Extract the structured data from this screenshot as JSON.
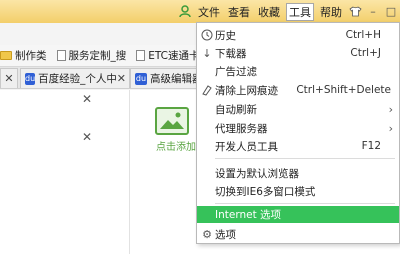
{
  "menubar": {
    "file": "文件",
    "view": "查看",
    "favorites": "收藏",
    "tools": "工具",
    "help": "帮助"
  },
  "bookmarks": [
    {
      "label": "制作类",
      "icon": "folder-icon"
    },
    {
      "label": "服务定制_搜",
      "icon": "page-icon"
    },
    {
      "label": "ETC速通卡",
      "icon": "page-icon"
    }
  ],
  "tabs": {
    "tab1_label": "百度经验_个人中",
    "tab2_label": "高级编辑器"
  },
  "content": {
    "photo_label": "点击添加"
  },
  "tools_menu": {
    "items": [
      {
        "label": "历史",
        "shortcut": "Ctrl+H",
        "icon": "history-icon"
      },
      {
        "label": "下载器",
        "shortcut": "Ctrl+J",
        "icon": "download-icon"
      },
      {
        "label": "广告过滤",
        "shortcut": "",
        "icon": ""
      },
      {
        "label": "清除上网痕迹",
        "shortcut": "Ctrl+Shift+Delete",
        "icon": "clear-icon"
      },
      {
        "label": "自动刷新",
        "shortcut": "",
        "icon": "",
        "submenu": true
      },
      {
        "label": "代理服务器",
        "shortcut": "",
        "icon": "",
        "submenu": true
      },
      {
        "label": "开发人员工具",
        "shortcut": "F12",
        "icon": ""
      },
      {
        "label": "设置为默认浏览器",
        "shortcut": "",
        "icon": ""
      },
      {
        "label": "切换到IE6多窗口模式",
        "shortcut": "",
        "icon": ""
      },
      {
        "label": "Internet 选项",
        "shortcut": "",
        "icon": "",
        "highlighted": true
      },
      {
        "label": "选项",
        "shortcut": "",
        "icon": "gear-icon"
      }
    ]
  },
  "colors": {
    "highlight": "#36c25a",
    "titlebar": "#f3cf6a"
  }
}
